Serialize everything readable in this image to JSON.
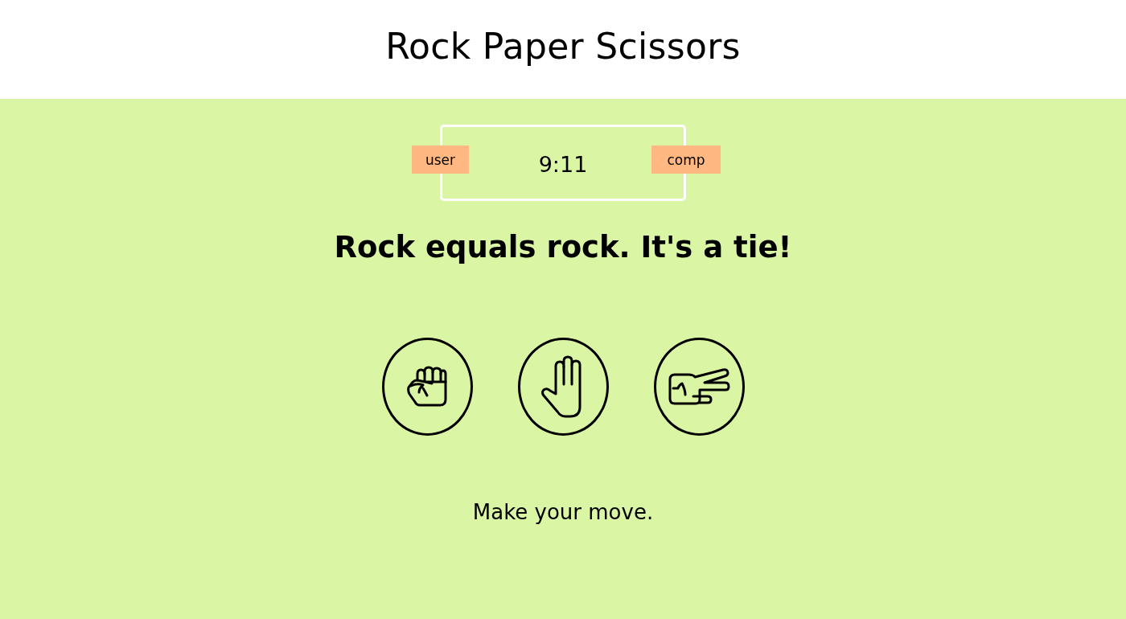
{
  "header": {
    "title": "Rock Paper Scissors"
  },
  "scoreboard": {
    "user_label": "user",
    "score": "9:11",
    "comp_label": "comp"
  },
  "result": {
    "message": "Rock equals rock. It's a tie!"
  },
  "choices": [
    {
      "kind": "rock"
    },
    {
      "kind": "paper"
    },
    {
      "kind": "scissors"
    }
  ],
  "prompt": "Make your move."
}
